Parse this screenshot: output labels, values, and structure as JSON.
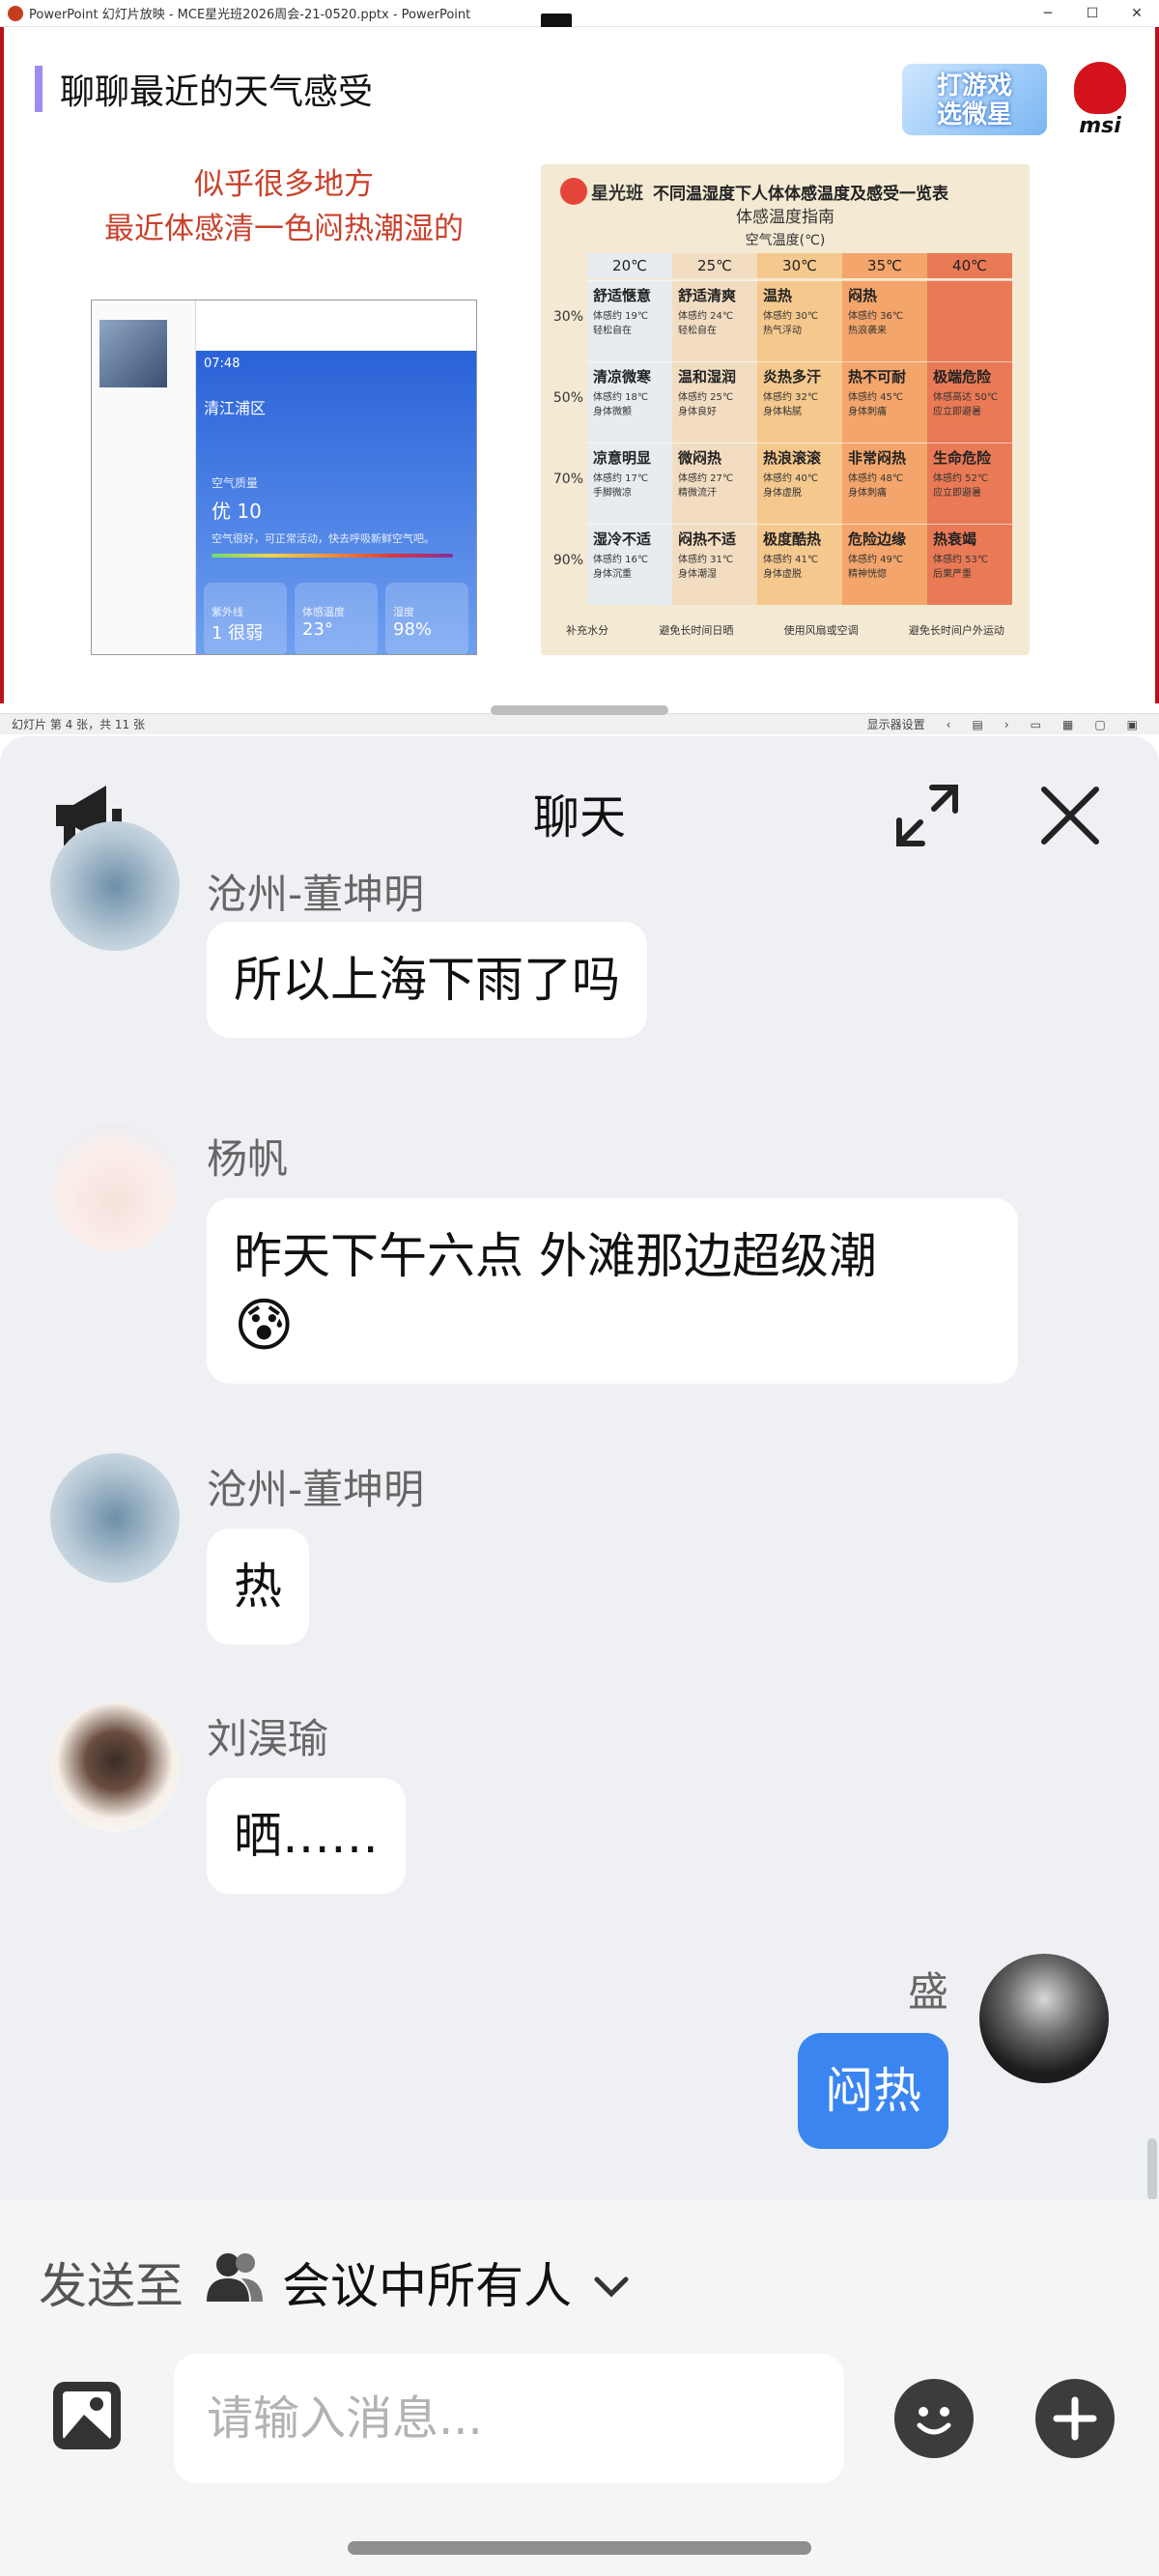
{
  "ppt": {
    "window_title": "PowerPoint 幻灯片放映 - MCE星光班2026周会-21-0520.pptx - PowerPoint",
    "window_buttons": {
      "minimize": "─",
      "maximize": "☐",
      "close": "✕"
    },
    "status": {
      "slide_info": "幻灯片 第 4 张，共 11 张",
      "display_settings": "显示器设置"
    }
  },
  "slide": {
    "title": "聊聊最近的天气感受",
    "promo_badge": "打游戏\n选微星",
    "brand_logo_text": "msi",
    "caption_line1": "似乎很多地方",
    "caption_line2": "最近体感清一色闷热潮湿的",
    "phone": {
      "time": "07:48",
      "city": "清江浦区",
      "air_quality_label": "空气质量",
      "air_quality_value": "优 10",
      "air_quality_desc": "空气很好，可正常活动，快去呼吸新鲜空气吧。",
      "cards": [
        {
          "label": "紫外线",
          "value": "1 很弱"
        },
        {
          "label": "体感温度",
          "value": "23°"
        },
        {
          "label": "湿度",
          "value": "98%"
        }
      ]
    },
    "table": {
      "brand": "星光班",
      "title": "不同温湿度下人体体感温度及感受一览表",
      "subtitle": "体感温度指南",
      "axis_label": "空气温度(℃)",
      "columns": [
        "20℃",
        "25℃",
        "30℃",
        "35℃",
        "40℃"
      ],
      "rows": [
        {
          "humidity": "30%",
          "cells": [
            {
              "name": "舒适惬意",
              "feel": "体感约 19℃",
              "desc": "轻松自在"
            },
            {
              "name": "舒适清爽",
              "feel": "体感约 24℃",
              "desc": "轻松自在"
            },
            {
              "name": "温热",
              "feel": "体感约 30℃",
              "desc": "热气浮动"
            },
            {
              "name": "闷热",
              "feel": "体感约 36℃",
              "desc": "热浪袭来"
            },
            {
              "name": "",
              "feel": "",
              "desc": ""
            }
          ]
        },
        {
          "humidity": "50%",
          "cells": [
            {
              "name": "清凉微寒",
              "feel": "体感约 18℃",
              "desc": "身体微颤"
            },
            {
              "name": "温和湿润",
              "feel": "体感约 25℃",
              "desc": "身体良好"
            },
            {
              "name": "炎热多汗",
              "feel": "体感约 32℃",
              "desc": "身体粘腻"
            },
            {
              "name": "热不可耐",
              "feel": "体感约 45℃",
              "desc": "身体刺痛"
            },
            {
              "name": "极端危险",
              "feel": "体感高达 50℃",
              "desc": "应立即避暑"
            }
          ]
        },
        {
          "humidity": "70%",
          "cells": [
            {
              "name": "凉意明显",
              "feel": "体感约 17℃",
              "desc": "手脚微凉"
            },
            {
              "name": "微闷热",
              "feel": "体感约 27℃",
              "desc": "精微流汗"
            },
            {
              "name": "热浪滚滚",
              "feel": "体感约 40℃",
              "desc": "身体虚脱"
            },
            {
              "name": "非常闷热",
              "feel": "体感约 48℃",
              "desc": "身体刺痛"
            },
            {
              "name": "生命危险",
              "feel": "体感约 52℃",
              "desc": "应立即避暑"
            }
          ]
        },
        {
          "humidity": "90%",
          "cells": [
            {
              "name": "湿冷不适",
              "feel": "体感约 16℃",
              "desc": "身体沉重"
            },
            {
              "name": "闷热不适",
              "feel": "体感约 31℃",
              "desc": "身体潮湿"
            },
            {
              "name": "极度酷热",
              "feel": "体感约 41℃",
              "desc": "身体虚脱"
            },
            {
              "name": "危险边缘",
              "feel": "体感约 49℃",
              "desc": "精神恍惚"
            },
            {
              "name": "热衰竭",
              "feel": "体感约 53℃",
              "desc": "后果严重"
            }
          ]
        }
      ],
      "legend": [
        "补充水分",
        "避免长时间日晒",
        "使用风扇或空调",
        "避免长时间户外运动"
      ]
    }
  },
  "chat": {
    "title": "聊天",
    "messages": [
      {
        "sender": "沧州-董坤明",
        "text": "所以上海下雨了吗",
        "mine": false
      },
      {
        "sender": "杨帆",
        "text": "昨天下午六点 外滩那边超级潮",
        "emoji": "😰",
        "mine": false
      },
      {
        "sender": "沧州-董坤明",
        "text": "热",
        "mine": false
      },
      {
        "sender": "刘淏瑜",
        "text": "晒……",
        "mine": false
      },
      {
        "sender": "盛",
        "text": "闷热",
        "mine": true
      }
    ],
    "send_to_label": "发送至",
    "send_to_target": "会议中所有人",
    "input_placeholder": "请输入消息..."
  },
  "colors": {
    "accent_blue": "#3a85ef",
    "slide_border": "#b5121b",
    "caption_red": "#c8412b"
  },
  "icons": {
    "announcement": "megaphone-icon",
    "expand": "expand-icon",
    "close": "close-icon",
    "participants": "people-icon",
    "dropdown": "chevron-down-icon",
    "image": "image-icon",
    "emoji": "emoji-icon",
    "add": "plus-icon"
  }
}
